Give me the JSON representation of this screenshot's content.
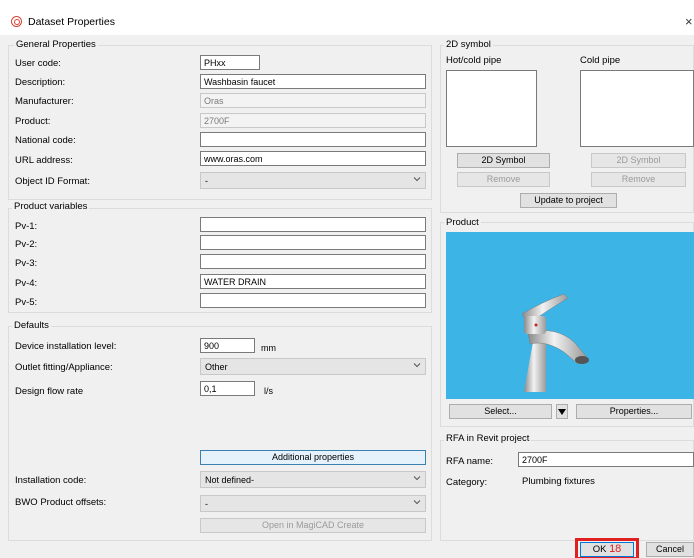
{
  "window": {
    "title": "Dataset Properties",
    "close_glyph": "×"
  },
  "general": {
    "title": "General Properties",
    "fields": [
      {
        "label": "User code:",
        "value": "PHxx",
        "readonly": false
      },
      {
        "label": "Description:",
        "value": "Washbasin faucet",
        "readonly": false
      },
      {
        "label": "Manufacturer:",
        "value": "Oras",
        "readonly": true
      },
      {
        "label": "Product:",
        "value": "2700F",
        "readonly": true
      },
      {
        "label": "National code:",
        "value": "",
        "readonly": false
      },
      {
        "label": "URL address:",
        "value": "www.oras.com",
        "readonly": false
      }
    ],
    "object_id_format": {
      "label": "Object ID Format:",
      "value": "-"
    }
  },
  "product_variables": {
    "title": "Product variables",
    "fields": [
      {
        "label": "Pv-1:",
        "value": ""
      },
      {
        "label": "Pv-2:",
        "value": ""
      },
      {
        "label": "Pv-3:",
        "value": ""
      },
      {
        "label": "Pv-4:",
        "value": "WATER DRAIN"
      },
      {
        "label": "Pv-5:",
        "value": ""
      }
    ]
  },
  "defaults": {
    "title": "Defaults",
    "device_installation_level": {
      "label": "Device installation level:",
      "value": "900",
      "unit": "mm"
    },
    "outlet_fitting": {
      "label": "Outlet fitting/Appliance:",
      "value": "Other"
    },
    "design_flow_rate": {
      "label": "Design flow rate",
      "value": "0,1",
      "unit": "l/s"
    },
    "additional_properties_label": "Additional properties",
    "installation_code": {
      "label": "Installation code:",
      "value": "Not defined-"
    },
    "bwo_offsets": {
      "label": "BWO Product offsets:",
      "value": "-"
    },
    "open_magicad_label": "Open in MagiCAD Create"
  },
  "symbol2d": {
    "title": "2D symbol",
    "hot_cold_label": "Hot/cold pipe",
    "cold_label": "Cold pipe",
    "symbol_button_label": "2D Symbol",
    "remove_button_label": "Remove",
    "update_button_label": "Update to project"
  },
  "product": {
    "title": "Product",
    "select_label": "Select...",
    "properties_label": "Properties...",
    "preview_background": "#3db4e6"
  },
  "rfa": {
    "title": "RFA in Revit project",
    "name_label": "RFA name:",
    "name_value": "2700F",
    "category_label": "Category:",
    "category_value": "Plumbing fixtures"
  },
  "footer": {
    "ok_label": "OK",
    "ok_annotation": "18",
    "cancel_label": "Cancel",
    "highlight_color": "#e02020"
  }
}
